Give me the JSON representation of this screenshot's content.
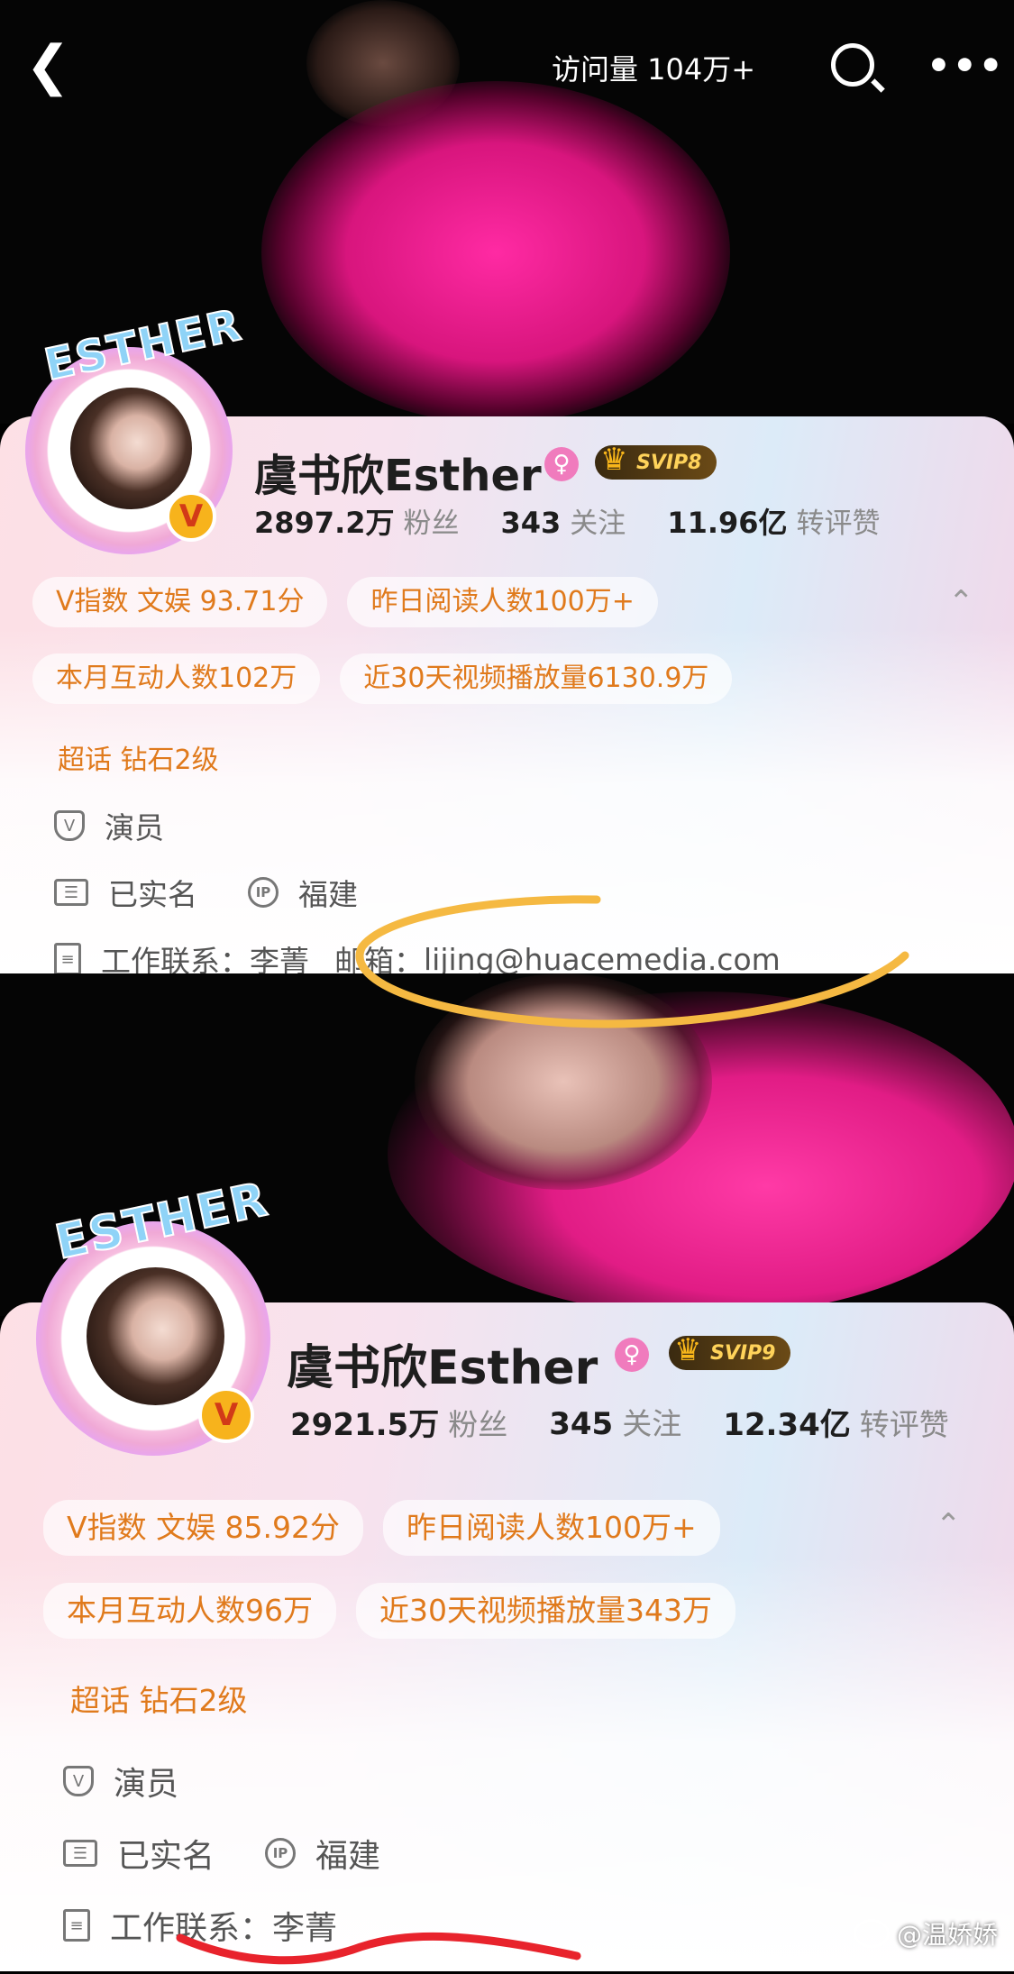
{
  "top_bar": {
    "back_icon": "chevron-left-icon",
    "visits_label": "访问量 104万+",
    "search_icon": "search-icon",
    "more_icon": "more-horizontal-icon"
  },
  "profiles": [
    {
      "avatar_text": "ESTHER",
      "username": "虞书欣Esther",
      "gender_icon": "female-icon",
      "svip_label": "SVIP8",
      "verified_badge": "V",
      "stats": [
        {
          "value": "2897.2万",
          "label": "粉丝"
        },
        {
          "value": "343",
          "label": "关注"
        },
        {
          "value": "11.96亿",
          "label": "转评赞"
        }
      ],
      "chips_row1": [
        "V指数 文娱 93.71分",
        "昨日阅读人数100万+"
      ],
      "chips_row2": [
        "本月互动人数102万",
        "近30天视频播放量6130.9万"
      ],
      "supertopic": "超话 钻石2级",
      "occupation": "演员",
      "realname": "已实名",
      "ip_location": "福建",
      "work_contact_label": "工作联系：",
      "work_contact_name": "李菁",
      "email_label": "邮箱：",
      "email": "lijing@huacemedia.com"
    },
    {
      "avatar_text": "ESTHER",
      "username": "虞书欣Esther",
      "gender_icon": "female-icon",
      "svip_label": "SVIP9",
      "verified_badge": "V",
      "stats": [
        {
          "value": "2921.5万",
          "label": "粉丝"
        },
        {
          "value": "345",
          "label": "关注"
        },
        {
          "value": "12.34亿",
          "label": "转评赞"
        }
      ],
      "chips_row1": [
        "V指数 文娱 85.92分",
        "昨日阅读人数100万+"
      ],
      "chips_row2": [
        "本月互动人数96万",
        "近30天视频播放量343万"
      ],
      "supertopic": "超话 钻石2级",
      "occupation": "演员",
      "realname": "已实名",
      "ip_location": "福建",
      "work_contact_label": "工作联系：",
      "work_contact_name": "李菁"
    }
  ],
  "watermark": "@温娇娇",
  "colors": {
    "accent_orange": "#e07a1c",
    "highlight_yellow": "#f5b942",
    "highlight_red": "#e8232c",
    "hero_pink": "#e11c85"
  }
}
